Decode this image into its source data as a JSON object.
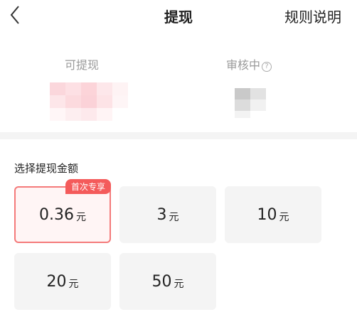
{
  "header": {
    "title": "提现",
    "rules_label": "规则说明"
  },
  "balance": {
    "available_label": "可提现",
    "reviewing_label": "审核中",
    "help_icon": "?"
  },
  "amount_section": {
    "title": "选择提现金额",
    "options": [
      {
        "amount": "0.36",
        "unit": "元",
        "badge": "首次专享",
        "selected": true
      },
      {
        "amount": "3",
        "unit": "元"
      },
      {
        "amount": "10",
        "unit": "元"
      },
      {
        "amount": "20",
        "unit": "元"
      },
      {
        "amount": "50",
        "unit": "元"
      }
    ]
  },
  "colors": {
    "accent": "#f45b5b",
    "card_bg": "#f4f4f4",
    "selected_border": "#f47a7a"
  },
  "icons": {
    "back": "chevron-left-icon",
    "help": "question-circle-icon"
  }
}
